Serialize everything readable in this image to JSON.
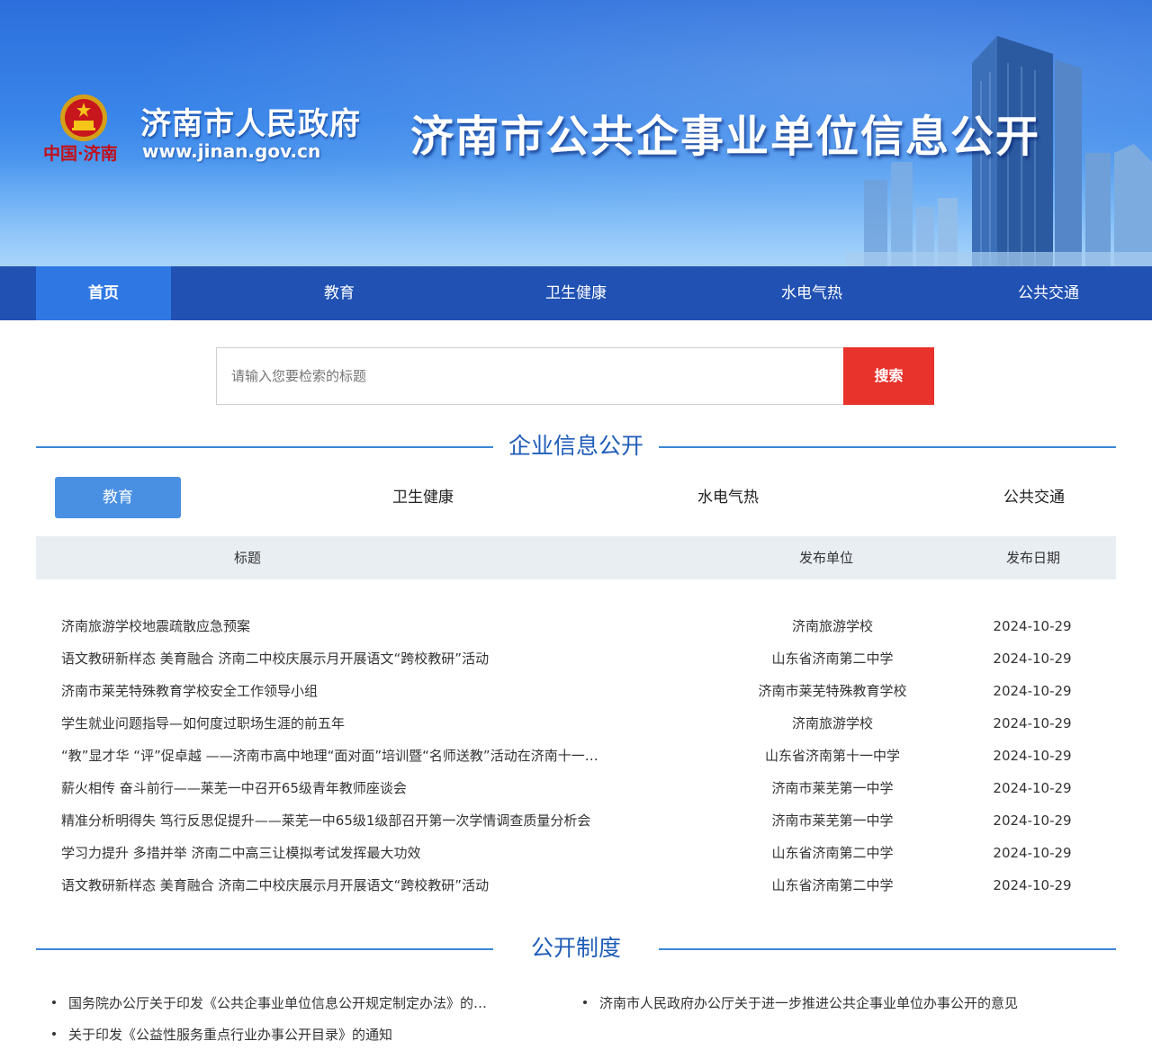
{
  "header": {
    "gov_name": "济南市人民政府",
    "gov_url": "www.jinan.gov.cn",
    "emblem_caption": "中国·济南",
    "site_title": "济南市公共企事业单位信息公开"
  },
  "nav": {
    "items": [
      {
        "label": "首页",
        "active": true
      },
      {
        "label": "教育"
      },
      {
        "label": "卫生健康"
      },
      {
        "label": "水电气热"
      },
      {
        "label": "公共交通"
      }
    ]
  },
  "search": {
    "placeholder": "请输入您要检索的标题",
    "button_label": "搜索"
  },
  "enterprise_section": {
    "title": "企业信息公开",
    "tabs": [
      {
        "label": "教育",
        "active": true
      },
      {
        "label": "卫生健康"
      },
      {
        "label": "水电气热"
      },
      {
        "label": "公共交通"
      }
    ],
    "columns": {
      "title": "标题",
      "unit": "发布单位",
      "date": "发布日期"
    },
    "rows": [
      {
        "title": "济南旅游学校地震疏散应急预案",
        "unit": "济南旅游学校",
        "date": "2024-10-29"
      },
      {
        "title": "语文教研新样态 美育融合 济南二中校庆展示月开展语文“跨校教研”活动",
        "unit": "山东省济南第二中学",
        "date": "2024-10-29"
      },
      {
        "title": "济南市莱芜特殊教育学校安全工作领导小组",
        "unit": "济南市莱芜特殊教育学校",
        "date": "2024-10-29"
      },
      {
        "title": "学生就业问题指导—如何度过职场生涯的前五年",
        "unit": "济南旅游学校",
        "date": "2024-10-29"
      },
      {
        "title": "“教”显才华 “评”促卓越 ——济南市高中地理“面对面”培训暨“名师送教”活动在济南十一…",
        "unit": "山东省济南第十一中学",
        "date": "2024-10-29"
      },
      {
        "title": "薪火相传 奋斗前行——莱芜一中召开65级青年教师座谈会",
        "unit": "济南市莱芜第一中学",
        "date": "2024-10-29"
      },
      {
        "title": "精准分析明得失 笃行反思促提升——莱芜一中65级1级部召开第一次学情调查质量分析会",
        "unit": "济南市莱芜第一中学",
        "date": "2024-10-29"
      },
      {
        "title": "学习力提升 多措并举 济南二中高三让模拟考试发挥最大功效",
        "unit": "山东省济南第二中学",
        "date": "2024-10-29"
      },
      {
        "title": "语文教研新样态 美育融合 济南二中校庆展示月开展语文“跨校教研”活动",
        "unit": "山东省济南第二中学",
        "date": "2024-10-29"
      }
    ]
  },
  "policy_section": {
    "title": "公开制度",
    "links": [
      "国务院办公厅关于印发《公共企事业单位信息公开规定制定办法》的…",
      "济南市人民政府办公厅关于进一步推进公共企事业单位办事公开的意见",
      "关于印发《公益性服务重点行业办事公开目录》的通知"
    ]
  },
  "colors": {
    "nav_bg": "#2051b3",
    "nav_active": "#2f78e4",
    "search_button": "#e8322c",
    "tab_active": "#4a90e2",
    "heading_blue": "#1f5db8",
    "table_header_bg": "#e9eef3"
  }
}
